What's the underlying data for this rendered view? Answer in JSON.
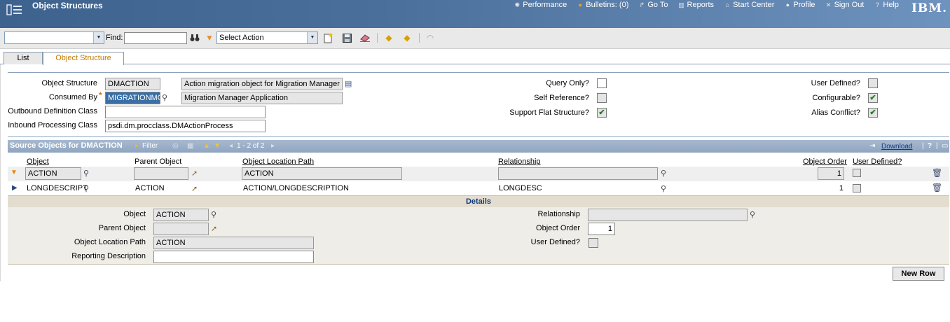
{
  "header": {
    "title": "Object Structures",
    "brand": "IBM.",
    "nav": [
      {
        "label": "Performance",
        "icon": "performance-icon"
      },
      {
        "label": "Bulletins: (0)",
        "icon": "bulletins-icon"
      },
      {
        "label": "Go To",
        "icon": "goto-icon"
      },
      {
        "label": "Reports",
        "icon": "reports-icon"
      },
      {
        "label": "Start Center",
        "icon": "home-icon"
      },
      {
        "label": "Profile",
        "icon": "profile-icon"
      },
      {
        "label": "Sign Out",
        "icon": "signout-icon"
      },
      {
        "label": "Help",
        "icon": "help-icon"
      }
    ]
  },
  "toolbar": {
    "query_value": "",
    "find_label": "Find:",
    "find_value": "",
    "action_select": "Select Action"
  },
  "tabs": [
    {
      "label": "List",
      "active": false
    },
    {
      "label": "Object Structure",
      "active": true
    }
  ],
  "form": {
    "object_structure_label": "Object Structure",
    "object_structure_value": "DMACTION",
    "object_structure_desc": "Action migration object for Migration Manager",
    "consumed_by_label": "Consumed By",
    "consumed_by_value": "MIGRATIONMGR",
    "consumed_by_desc": "Migration Manager Application",
    "outbound_label": "Outbound Definition Class",
    "outbound_value": "",
    "inbound_label": "Inbound Processing Class",
    "inbound_value": "psdi.dm.procclass.DMActionProcess",
    "query_only_label": "Query Only?",
    "query_only": false,
    "self_ref_label": "Self Reference?",
    "self_ref": false,
    "flat_label": "Support Flat Structure?",
    "flat": true,
    "user_defined_label": "User Defined?",
    "user_defined": false,
    "configurable_label": "Configurable?",
    "configurable": true,
    "alias_label": "Alias Conflict?",
    "alias": true
  },
  "source": {
    "title": "Source Objects for DMACTION",
    "filter": "Filter",
    "paging": "1 - 2 of 2",
    "download": "Download",
    "help": "?",
    "columns": {
      "object": "Object",
      "parent": "Parent Object",
      "path": "Object Location Path",
      "relationship": "Relationship",
      "order": "Object Order",
      "user_defined": "User Defined?"
    },
    "rows": [
      {
        "object": "ACTION",
        "parent": "",
        "path": "ACTION",
        "relationship": "",
        "order": "1"
      },
      {
        "object": "LONGDESCRIPT",
        "parent": "ACTION",
        "path": "ACTION/LONGDESCRIPTION",
        "relationship": "LONGDESC",
        "order": "1"
      }
    ]
  },
  "details": {
    "title": "Details",
    "object_label": "Object",
    "object_value": "ACTION",
    "parent_label": "Parent Object",
    "parent_value": "",
    "path_label": "Object Location Path",
    "path_value": "ACTION",
    "reporting_label": "Reporting Description",
    "reporting_value": "",
    "relationship_label": "Relationship",
    "relationship_value": "",
    "order_label": "Object Order",
    "order_value": "1",
    "user_defined_label": "User Defined?"
  },
  "new_row_label": "New Row"
}
